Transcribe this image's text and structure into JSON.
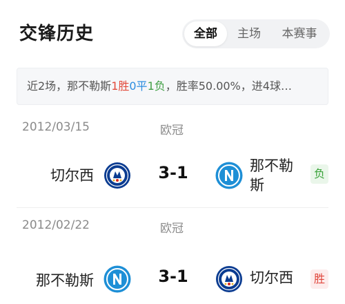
{
  "header": {
    "title": "交锋历史",
    "tabs": [
      {
        "label": "全部",
        "active": true
      },
      {
        "label": "主场",
        "active": false
      },
      {
        "label": "本赛事",
        "active": false
      }
    ]
  },
  "summary": {
    "prefix": "近2场，那不勒斯",
    "wins": "1胜",
    "draws": "0平",
    "losses": "1负",
    "suffix": "，胜率50.00%，进4球…"
  },
  "colors": {
    "win": "#e24a3b",
    "draw": "#2b8de0",
    "loss": "#43a047",
    "chelsea_blue": "#0b3c91",
    "napoli_blue": "#1e8fd6"
  },
  "matches": [
    {
      "date": "2012/03/15",
      "competition": "欧冠",
      "home": {
        "name": "切尔西",
        "logo": "chelsea-logo-icon"
      },
      "score": "3-1",
      "away": {
        "name": "那不勒斯",
        "logo": "napoli-logo-icon"
      },
      "result": "负"
    },
    {
      "date": "2012/02/22",
      "competition": "欧冠",
      "home": {
        "name": "那不勒斯",
        "logo": "napoli-logo-icon"
      },
      "score": "3-1",
      "away": {
        "name": "切尔西",
        "logo": "chelsea-logo-icon"
      },
      "result": "胜"
    }
  ]
}
